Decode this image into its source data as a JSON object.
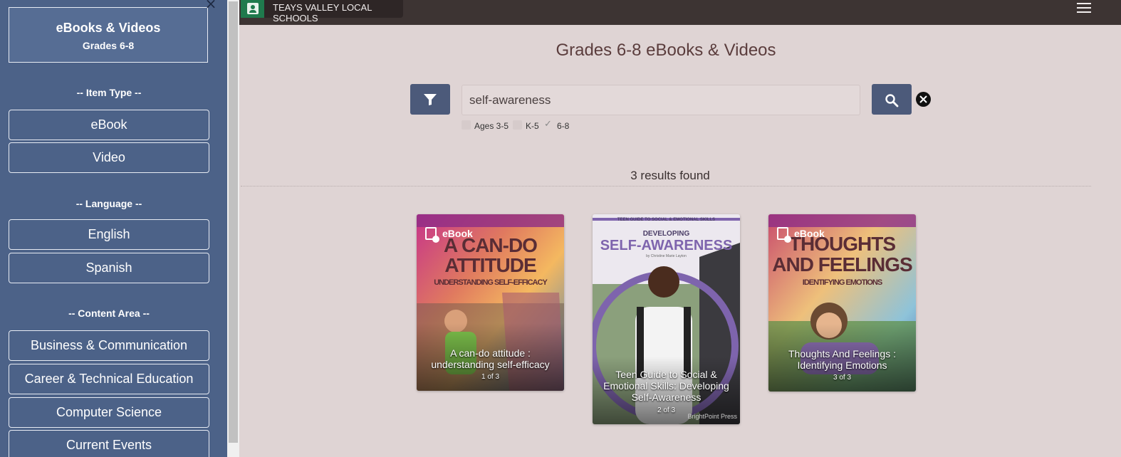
{
  "sidebar": {
    "title": "eBooks & Videos",
    "subtitle": "Grades 6-8",
    "sections": {
      "item_type": "-- Item Type --",
      "language": "-- Language --",
      "content_area": "-- Content Area --"
    },
    "item_type": [
      "eBook",
      "Video"
    ],
    "language": [
      "English",
      "Spanish"
    ],
    "content_area": [
      "Business & Communication",
      "Career & Technical Education",
      "Computer Science",
      "Current Events"
    ]
  },
  "topbar": {
    "school_name": "TEAYS VALLEY LOCAL SCHOOLS"
  },
  "main": {
    "page_title": "Grades 6-8 eBooks & Videos",
    "search_value": "self-awareness",
    "grades": [
      {
        "label": "Ages 3-5",
        "checked": false
      },
      {
        "label": "K-5",
        "checked": false
      },
      {
        "label": "6-8",
        "checked": true
      }
    ],
    "results_text": "3 results found"
  },
  "cards": [
    {
      "type_label": "eBook",
      "cover_line1": "A CAN-DO",
      "cover_line2": "ATTITUDE",
      "cover_sub": "UNDERSTANDING SELF-EFFICACY",
      "title": "A can-do attitude : understanding self-efficacy",
      "position": "1 of 3"
    },
    {
      "type_label": "",
      "cover_header": "TEEN GUIDE TO SOCIAL & EMOTIONAL SKILLS",
      "cover_line1": "DEVELOPING",
      "cover_line2": "SELF-AWARENESS",
      "cover_author": "by Christine Marie Layton",
      "title": "Teen Guide to Social & Emotional Skills: Developing Self-Awareness",
      "position": "2 of 3",
      "publisher": "BrightPoint Press"
    },
    {
      "type_label": "eBook",
      "cover_line1": "THOUGHTS",
      "cover_line2": "AND FEELINGS",
      "cover_sub": "IDENTIFYING EMOTIONS",
      "title": "Thoughts And Feelings : Identifying Emotions",
      "position": "3 of 3"
    }
  ],
  "colors": {
    "sidebar_bg": "#4c6288",
    "topbar_bg": "#3d3433",
    "main_bg": "#dfd4d4",
    "button_bg": "#4c5a7a",
    "cover2_accent": "#7e64ad"
  },
  "icons": {
    "filter": "funnel-icon",
    "search": "magnifier-icon",
    "clear": "close-circle-icon",
    "menu": "hamburger-icon",
    "close_sidebar": "close-icon"
  }
}
